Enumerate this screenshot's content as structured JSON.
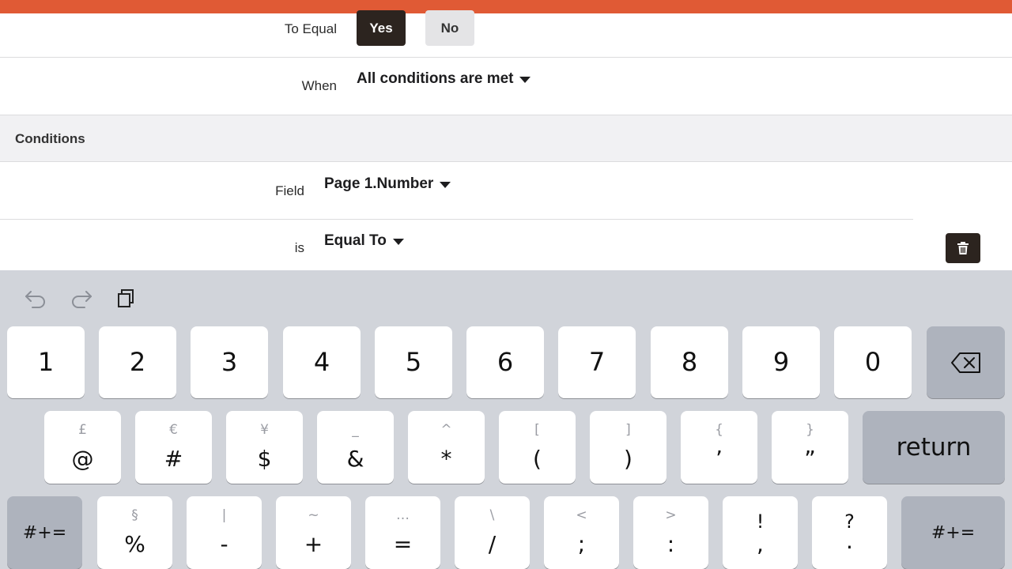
{
  "form": {
    "to_equal_label": "To Equal",
    "yes_label": "Yes",
    "no_label": "No",
    "when_label": "When",
    "when_value": "All conditions are met",
    "conditions_heading": "Conditions",
    "field_label": "Field",
    "field_value": "Page 1.Number",
    "is_label": "is",
    "is_value": "Equal To"
  },
  "colors": {
    "topbar": "#e05a35",
    "dark_button": "#2c241f",
    "keyboard_bg": "#d1d4da"
  },
  "keyboard": {
    "toolbar_icons": [
      "undo-icon",
      "redo-icon",
      "paste-icon"
    ],
    "row1": [
      {
        "main": "1"
      },
      {
        "main": "2"
      },
      {
        "main": "3"
      },
      {
        "main": "4"
      },
      {
        "main": "5"
      },
      {
        "main": "6"
      },
      {
        "main": "7"
      },
      {
        "main": "8"
      },
      {
        "main": "9"
      },
      {
        "main": "0"
      }
    ],
    "delete_icon": "backspace-icon",
    "row2": [
      {
        "sub": "£",
        "main": "@"
      },
      {
        "sub": "€",
        "main": "#"
      },
      {
        "sub": "¥",
        "main": "$"
      },
      {
        "sub": "_",
        "main": "&"
      },
      {
        "sub": "^",
        "main": "*"
      },
      {
        "sub": "[",
        "main": "("
      },
      {
        "sub": "]",
        "main": ")"
      },
      {
        "sub": "{",
        "main": "’"
      },
      {
        "sub": "}",
        "main": "”"
      }
    ],
    "return_label": "return",
    "row3": [
      {
        "sub": "§",
        "main": "%"
      },
      {
        "sub": "|",
        "main": "-"
      },
      {
        "sub": "~",
        "main": "+"
      },
      {
        "sub": "…",
        "main": "="
      },
      {
        "sub": "\\",
        "main": "/"
      },
      {
        "sub": "<",
        "main": ";"
      },
      {
        "sub": ">",
        "main": ":"
      },
      {
        "sub": "!",
        "main": ","
      },
      {
        "sub": "?",
        "main": "."
      }
    ],
    "shift_left_label": "#+=",
    "shift_right_label": "#+="
  }
}
